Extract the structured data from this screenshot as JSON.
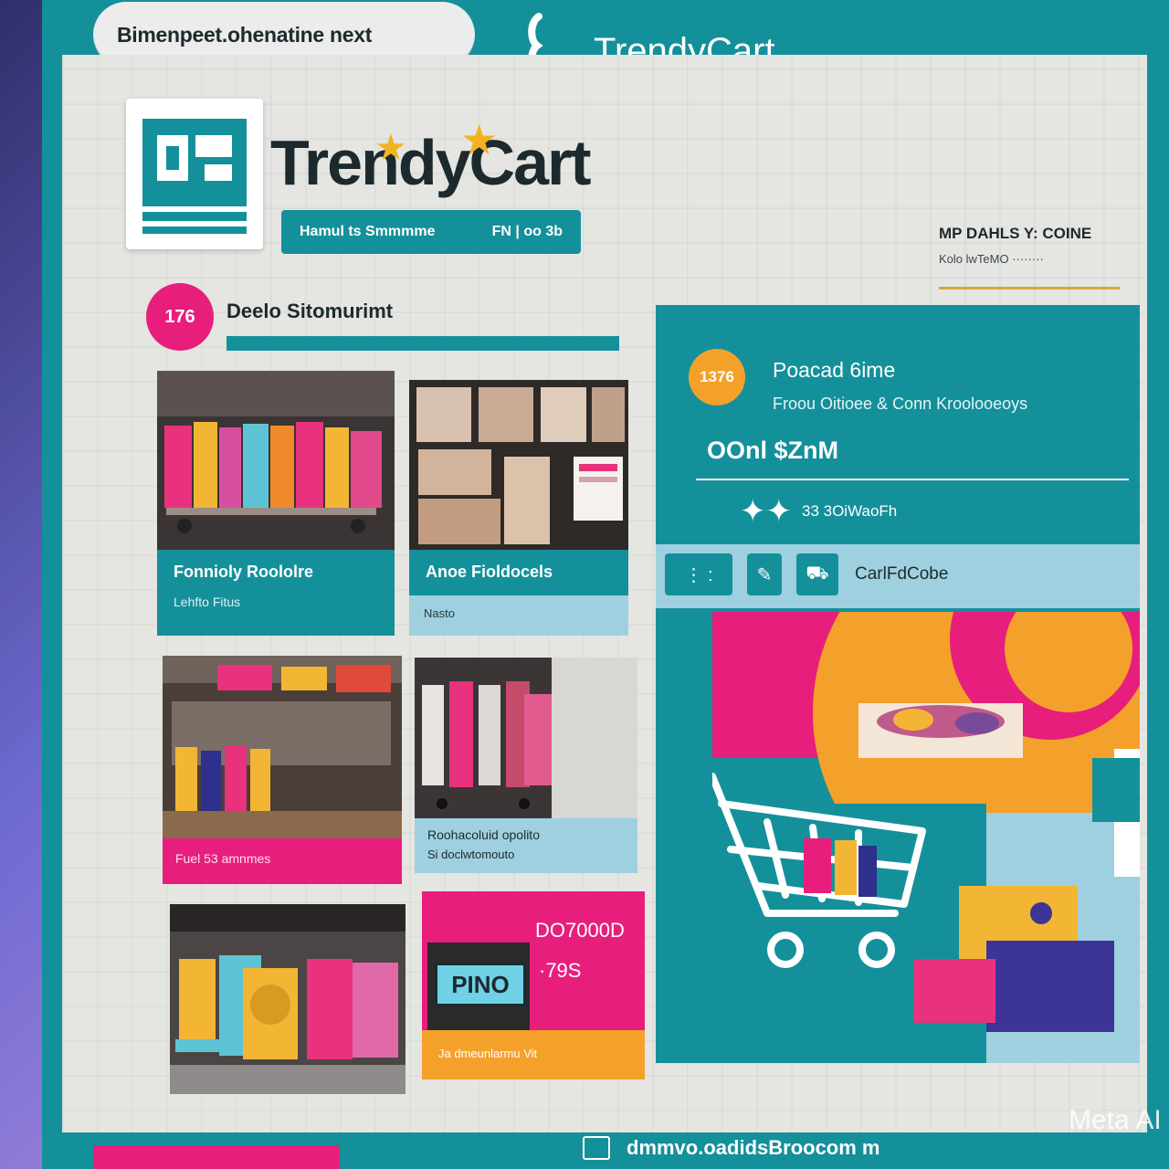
{
  "browser": {
    "url_text": "Bimenpeet.ohenatine next",
    "app_title": "TrendyCart"
  },
  "header": {
    "brand": "TrendyCart",
    "tagline_left": "Hamul ts Smmmme",
    "tagline_right": "FN | oo 3b",
    "account_line1": "MP DAHLS Y: COINE",
    "account_line2": "Kolo lwTeMO ········"
  },
  "section": {
    "badge": "176",
    "title": "Deelo Sitomurimt"
  },
  "products": [
    {
      "title": "Fonnioly Roololre",
      "subtitle": "Lehfto Fitus"
    },
    {
      "title": "Anoe Fioldocels",
      "subtitle": "Nasto"
    },
    {
      "title": "",
      "subtitle": "Fuel 53 amnmes"
    },
    {
      "title": "Roohacoluid opolito",
      "subtitle": "Si doclwtomouto"
    },
    {
      "title": "",
      "subtitle": "",
      "promo_sign": "PINO",
      "promo_title": "DO7000D",
      "promo_price": "·79S",
      "promo_footer": "Ja dmeunlarmu Vit"
    }
  ],
  "detail": {
    "badge": "1376",
    "title": "Poacad 6ime",
    "subtitle": "Froou Oitioee & Conn Kroolooeoys",
    "price": "OOnl $ZnM",
    "stars": "✦✦",
    "rating_text": "33 3OiWaoFh",
    "toolbar_label": "CarlFdCobe"
  },
  "footer": {
    "url": "dmmvo.oadidsBroocom m"
  },
  "watermark": "Meta AI",
  "colors": {
    "teal": "#14909b",
    "pink": "#e81e7c",
    "orange": "#f4a12b",
    "light_blue": "#9fd0e0",
    "page_bg": "#e5e5e2"
  }
}
